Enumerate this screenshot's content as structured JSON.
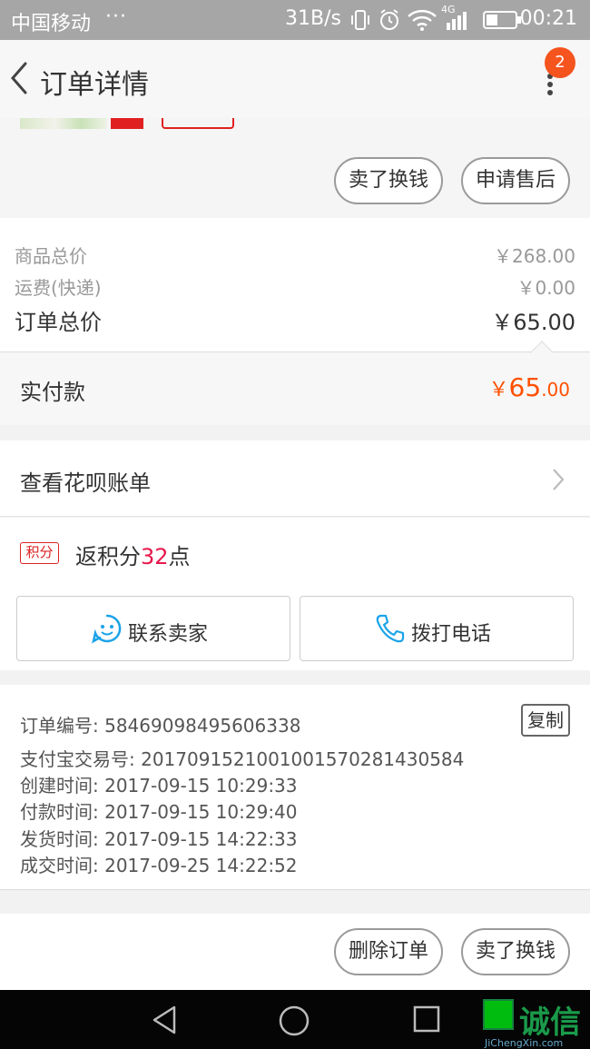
{
  "status_bar": {
    "carrier": "中国移动",
    "dots": "···",
    "speed": "31B/s",
    "network": "4G",
    "time": "00:21"
  },
  "header": {
    "title": "订单详情",
    "badge_count": "2"
  },
  "top_actions": {
    "sell_label": "卖了换钱",
    "after_sale_label": "申请售后"
  },
  "prices": {
    "goods_total_label": "商品总价",
    "goods_total_value": "￥268.00",
    "shipping_label": "运费(快递)",
    "shipping_value": "￥0.00",
    "order_total_label": "订单总价",
    "order_total_value": "￥65.00"
  },
  "paid": {
    "label": "实付款",
    "currency": "￥",
    "integer": "65",
    "decimal": ".00"
  },
  "huabei": {
    "label": "查看花呗账单"
  },
  "points": {
    "tag": "积分",
    "prefix": "返积分",
    "number": "32",
    "suffix": "点"
  },
  "contact": {
    "seller_label": "联系卖家",
    "phone_label": "拨打电话"
  },
  "order_info": {
    "order_no": "订单编号: 58469098495606338",
    "copy_label": "复制",
    "alipay_no": "支付宝交易号: 2017091521001001570281430584",
    "created": "创建时间: 2017-09-15 10:29:33",
    "paid": "付款时间: 2017-09-15 10:29:40",
    "shipped": "发货时间: 2017-09-15 14:22:33",
    "completed": "成交时间: 2017-09-25 14:22:52"
  },
  "footer": {
    "delete_label": "删除订单",
    "sell_label": "卖了换钱"
  },
  "watermark": {
    "text": "诚信",
    "url": "JiChengXin.com"
  },
  "colors": {
    "accent_orange": "#ff5000",
    "points_red": "#e8174a",
    "badge_orange": "#f5541e"
  }
}
